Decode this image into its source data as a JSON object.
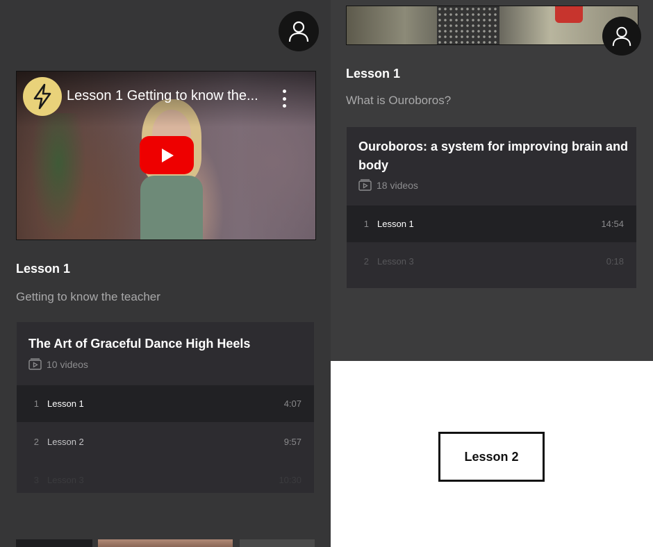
{
  "left": {
    "video": {
      "title": "Lesson 1 Getting to know the...",
      "channel_icon": "lightning-icon",
      "play_color": "#ee0000",
      "logo_color": "#e9d27a"
    },
    "lesson_heading": "Lesson 1",
    "lesson_subtitle": "Getting to know the teacher",
    "course": {
      "title": "The Art of Graceful Dance High Heels",
      "video_count": "10 videos",
      "lessons": [
        {
          "num": "1",
          "title": "Lesson 1",
          "duration": "4:07"
        },
        {
          "num": "2",
          "title": "Lesson 2",
          "duration": "9:57"
        },
        {
          "num": "3",
          "title": "Lesson 3",
          "duration": "10:30"
        }
      ]
    }
  },
  "right": {
    "lesson_heading": "Lesson 1",
    "lesson_subtitle": "What is Ouroboros?",
    "course": {
      "title": "Ouroboros: a system for improving brain and body",
      "video_count": "18 videos",
      "lessons": [
        {
          "num": "1",
          "title": "Lesson 1",
          "duration": "14:54"
        },
        {
          "num": "2",
          "title": "Lesson 3",
          "duration": "0:18"
        }
      ]
    }
  },
  "bottom_right": {
    "label": "Lesson 2"
  },
  "colors": {
    "background": "#363637",
    "card": "#2d2c30",
    "active_row": "#212124",
    "avatar": "#141414"
  }
}
